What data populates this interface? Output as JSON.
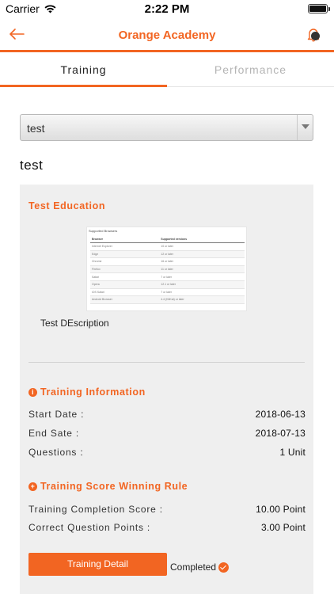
{
  "status_bar": {
    "carrier": "Carrier",
    "time": "2:22 PM",
    "battery_level": 1.0
  },
  "nav": {
    "title": "Orange Academy",
    "accent_color": "#f26522"
  },
  "tabs": [
    {
      "label": "Training",
      "active": true
    },
    {
      "label": "Performance",
      "active": false
    }
  ],
  "select": {
    "value": "test"
  },
  "page_heading": "test",
  "education": {
    "title": "Test Education",
    "description": "Test DEscription",
    "thumbnail": {
      "caption": "Supported Browsers",
      "headers": [
        "Browser",
        "Supported versions"
      ],
      "rows": [
        [
          "Internet Explorer",
          "10 or later"
        ],
        [
          "Edge",
          "12 or later"
        ],
        [
          "Chrome",
          "16 or later"
        ],
        [
          "Firefox",
          "11 or later"
        ],
        [
          "Safari",
          "7 or later"
        ],
        [
          "Opera",
          "12.1 or later"
        ],
        [
          "iOS Safari",
          "7 or later"
        ],
        [
          "Android Browser",
          "4.4 (KitKat) or later"
        ]
      ]
    }
  },
  "training_info": {
    "title": "Training Information",
    "rows": [
      {
        "label": "Start Date :",
        "value": "2018-06-13"
      },
      {
        "label": "End Sate :",
        "value": "2018-07-13"
      },
      {
        "label": "Questions :",
        "value": "1 Unit"
      }
    ]
  },
  "score_rule": {
    "title": "Training Score Winning Rule",
    "rows": [
      {
        "label": "Training Completion Score :",
        "value": "10.00 Point"
      },
      {
        "label": "Correct Question Points :",
        "value": "3.00 Point"
      }
    ]
  },
  "actions": {
    "detail_label": "Training Detail",
    "status_label": "Completed"
  }
}
